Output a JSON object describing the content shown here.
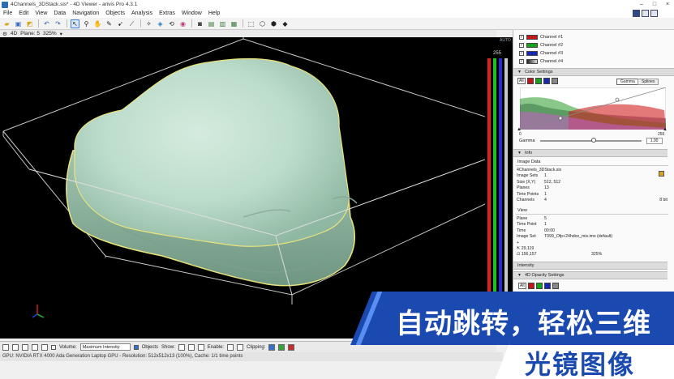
{
  "window": {
    "title": "4Channels_3DStack.sis* - 4D Viewer - arivis Pro 4.3.1",
    "controls": [
      "–",
      "□",
      "×"
    ]
  },
  "menu": [
    "File",
    "Edit",
    "View",
    "Data",
    "Navigation",
    "Objects",
    "Analysis",
    "Extras",
    "Window",
    "Help"
  ],
  "toolbar": {
    "icons": [
      "open-folder-icon",
      "save-icon",
      "stack-icon",
      "undo-icon",
      "redo-icon",
      "zoom-icon",
      "select-arrow-icon",
      "zoom-icon",
      "hand-pan-icon",
      "pen-icon",
      "pointer-icon",
      "measure-icon",
      "magic-wand-icon",
      "segment-icon",
      "rotate-icon",
      "color-wheel-icon",
      "camera-icon",
      "image-icon",
      "movie-icon",
      "export-icon",
      "cube-front-icon",
      "cube-side-icon",
      "cube-top-icon",
      "cube-iso-icon"
    ]
  },
  "viewer": {
    "mode": "4D",
    "plane": "Plane: 5",
    "zoom": "325%"
  },
  "lut": {
    "auto": "AUTO",
    "max": "255",
    "colors": [
      "#e02020",
      "#20c020",
      "#2030d0",
      "#c8c8c8"
    ]
  },
  "channels": [
    {
      "name": "Channel #1",
      "color": "#c01818"
    },
    {
      "name": "Channel #2",
      "color": "#18a018"
    },
    {
      "name": "Channel #3",
      "color": "#1828b0"
    },
    {
      "name": "Channel #4",
      "color": "#b0b0b0"
    }
  ],
  "color_settings": {
    "header": "Color Settings",
    "all_label": "All",
    "tabs": [
      "Gamma",
      "Splines"
    ],
    "range_min": "0",
    "range_max": "255",
    "gamma_label": "Gamma",
    "gamma_value": "1.00"
  },
  "info": {
    "header": "Info",
    "image_data_header": "Image Data",
    "file": "4Channels_3DStack.sis",
    "rows": [
      {
        "k": "Image Sets",
        "v": "1"
      },
      {
        "k": "Size (X,Y)",
        "v": "512, 512"
      },
      {
        "k": "Planes",
        "v": "13"
      },
      {
        "k": "Time Points",
        "v": "1"
      },
      {
        "k": "Channels",
        "v": "4",
        "extra": "8 bit"
      }
    ],
    "view_header": "View",
    "view_rows": [
      {
        "k": "Plane",
        "v": "5"
      },
      {
        "k": "Time Point",
        "v": "1"
      },
      {
        "k": "Time",
        "v": "00:00"
      },
      {
        "k": "Image Set",
        "v": "T099_Ofp+24hdox_mis.ims (default)"
      }
    ],
    "coord1": "⇱ 29,119",
    "coord2": "⊡ 156,157",
    "coord2_zoom": "325%",
    "intensity_header": "Intensity",
    "opacity_header": "4D Opacity Settings"
  },
  "bottombar": {
    "volume_label": "Volume:",
    "volume_mode": "Maximum Intensity",
    "objects_label": "Objects",
    "show_label": "Show:",
    "enable_label": "Enable:",
    "clipping_label": "Clipping:"
  },
  "status": "GPU: NVIDIA RTX 4000 Ada Generation Laptop GPU - Resolution: 512x512x13 (100%), Cache: 1/1 time points",
  "banner": {
    "line1": "自动跳转，轻松三维",
    "line2": "光镜图像"
  }
}
